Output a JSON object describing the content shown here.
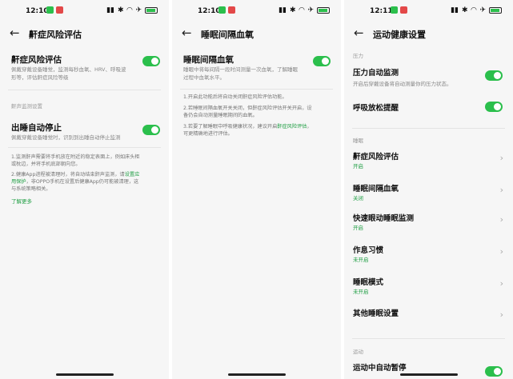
{
  "status_bar": [
    {
      "time": "12:10",
      "badge_colors": [
        "#2bbf4c",
        "#e34848"
      ]
    },
    {
      "time": "12:10",
      "badge_colors": [
        "#2bbf4c",
        "#e34848"
      ]
    },
    {
      "time": "12:11",
      "badge_colors": [
        "#2bbf4c",
        "#e34848"
      ]
    }
  ],
  "panel1": {
    "title": "鼾症风险评估",
    "main_toggle": {
      "label": "鼾症风险评估",
      "desc_line1": "佩戴穿戴设备睡觉，监测每秒血氧、HRV、呼吸波",
      "desc_line2": "形等，评估鼾症风险等级",
      "on": true
    },
    "section_label": "鼾声监测设置",
    "snore_stop": {
      "label": "出睡自动停止",
      "desc": "佩戴穿戴设备睡觉时，识别到出睡自动停止监测",
      "on": true
    },
    "notes": {
      "n1_line1": "1.监测鼾声需要将手机放在附近的稳定表面上，例如床头柜",
      "n1_line2": "或枕边，并将手机底部朝向您。",
      "n2_line1a": "2.健康App进程被清理时，将自动结束鼾声监测，请",
      "n2_link": "设置应",
      "n2_line2a": "用保护",
      "n2_line2b": "，非OPPO手机在设置后健康App仍可能被清理，这",
      "n2_line3": "与系统策略相关。"
    },
    "learn_more": "了解更多"
  },
  "panel2": {
    "title": "睡眠间隔血氧",
    "main_toggle": {
      "label": "睡眠间隔血氧",
      "desc_line1": "睡眠中将每间隔一段时间测量一次血氧，了解睡眠",
      "desc_line2": "过程中血氧水平。",
      "on": true
    },
    "notes": {
      "n1": "1.开启此功能后将自动关闭鼾症风险评估功能。",
      "n2_line1": "2.若睡眠间隔血氧开关关闭，但鼾症风险评估开关开启，设",
      "n2_line2": "备仍会自动测量睡眠期间的血氧。",
      "n3_line1a": "3.若要了解睡眠中呼吸健康状况，建议开启",
      "n3_link": "鼾症风险评估",
      "n3_line1b": "，",
      "n3_line2": "可更精确地进行评估。"
    }
  },
  "panel3": {
    "title": "运动健康设置",
    "section_pressure": "压力",
    "pressure_auto": {
      "label": "压力自动监测",
      "desc": "开启后穿戴设备将自动测量你的压力状态。",
      "on": true
    },
    "breath_remind": {
      "label": "呼吸放松提醒",
      "on": true
    },
    "section_sleep": "睡眠",
    "sleep_items": [
      {
        "label": "鼾症风险评估",
        "status": "开启"
      },
      {
        "label": "睡眠间隔血氧",
        "status": "关闭"
      },
      {
        "label": "快速眼动睡眠监测",
        "status": "开启"
      },
      {
        "label": "作息习惯",
        "status": "未开启"
      },
      {
        "label": "睡眠模式",
        "status": "未开启"
      },
      {
        "label": "其他睡眠设置",
        "status": ""
      }
    ],
    "section_sport": "运动",
    "sport_auto_pause": {
      "label": "运动中自动暂停",
      "on": true
    }
  },
  "icons": {
    "back": "back-arrow-icon",
    "chevron": "chevron-right-icon"
  },
  "colors": {
    "accent": "#2bbf4c",
    "link": "#1f9e43",
    "background": "#f6f6f6"
  }
}
